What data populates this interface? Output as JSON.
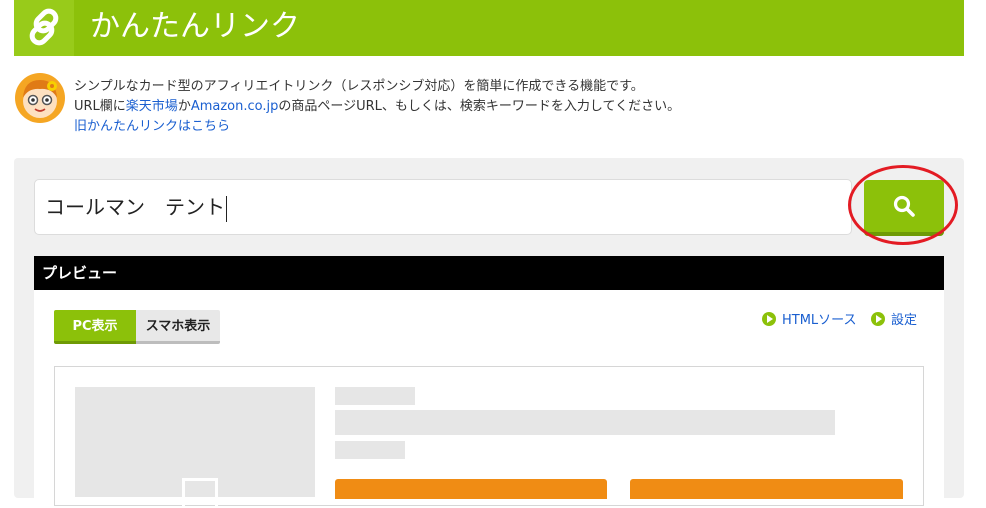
{
  "header": {
    "title": "かんたんリンク",
    "icon": "link-icon",
    "color": "#8cc10a"
  },
  "intro": {
    "line1": "シンプルなカード型のアフィリエイトリンク（レスポンシブ対応）を簡単に作成できる機能です。",
    "line2_prefix": "URL欄に",
    "line2_rakuten": "楽天市場",
    "line2_mid": "か",
    "line2_amazon": "Amazon.co.jp",
    "line2_suffix": "の商品ページURL、もしくは、検索キーワードを入力してください。",
    "old_link": "旧かんたんリンクはこちら"
  },
  "search": {
    "value": "コールマン　テント",
    "button_icon": "search-icon"
  },
  "preview": {
    "title": "プレビュー",
    "tabs": [
      {
        "label": "PC表示",
        "active": true
      },
      {
        "label": "スマホ表示",
        "active": false
      }
    ],
    "html_source_label": "HTMLソース",
    "settings_label": "設定"
  },
  "colors": {
    "accent": "#8cc10a",
    "link": "#1a5fd0",
    "annotation": "#e31b23",
    "buy_button": "#f08c14"
  }
}
